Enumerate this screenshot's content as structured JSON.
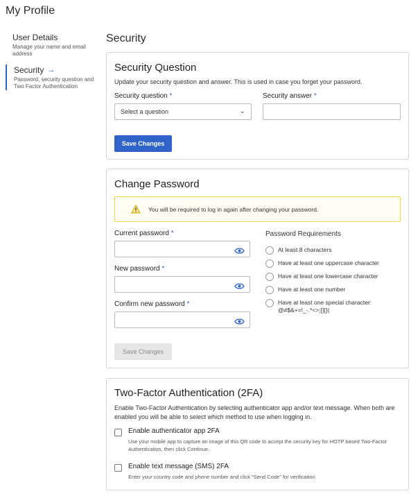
{
  "page": {
    "title": "My Profile",
    "section_title": "Security"
  },
  "nav": {
    "items": [
      {
        "label": "User Details",
        "desc": "Manage your name and email address"
      },
      {
        "label": "Security",
        "desc": "Password, security question and Two Factor Authentication",
        "active": true
      }
    ]
  },
  "security_question": {
    "title": "Security Question",
    "subtitle": "Update your security question and answer. This is used in case you forget your password.",
    "question_label": "Security question",
    "question_value": "Select a question",
    "answer_label": "Security answer",
    "answer_value": "",
    "required_mark": "*",
    "save_label": "Save Changes"
  },
  "change_password": {
    "title": "Change Password",
    "warning": "You will be required to log in again after changing your password.",
    "current_label": "Current password",
    "new_label": "New password",
    "confirm_label": "Confirm new password",
    "required_mark": "*",
    "requirements_title": "Password Requirements",
    "requirements": [
      "At least 8 characters",
      "Have at least one uppercase character",
      "Have at least one lowercase character",
      "Have at least one number",
      "Have at least one special character:"
    ],
    "special_chars": "@#$&+=!_-.*<>;[]{}|",
    "save_label": "Save Changes"
  },
  "two_factor": {
    "title": "Two-Factor Authentication (2FA)",
    "subtitle": "Enable Two-Factor Authentication by selecting authenticator app and/or text message. When both are enabled you will be able to select which method to use when logging in.",
    "app_label": "Enable authenticator app 2FA",
    "app_desc": "Use your mobile app to capture an image of this QR code to accept the security key for HOTP based Two-Factor Authentication, then click Continue.",
    "sms_label": "Enable text message (SMS) 2FA",
    "sms_desc": "Enter your country code and phone number and click \"Send Code\" for verification."
  },
  "colors": {
    "accent": "#2f63c9",
    "warning_border": "#f3d54a",
    "disabled_bg": "#e6e6e6"
  }
}
